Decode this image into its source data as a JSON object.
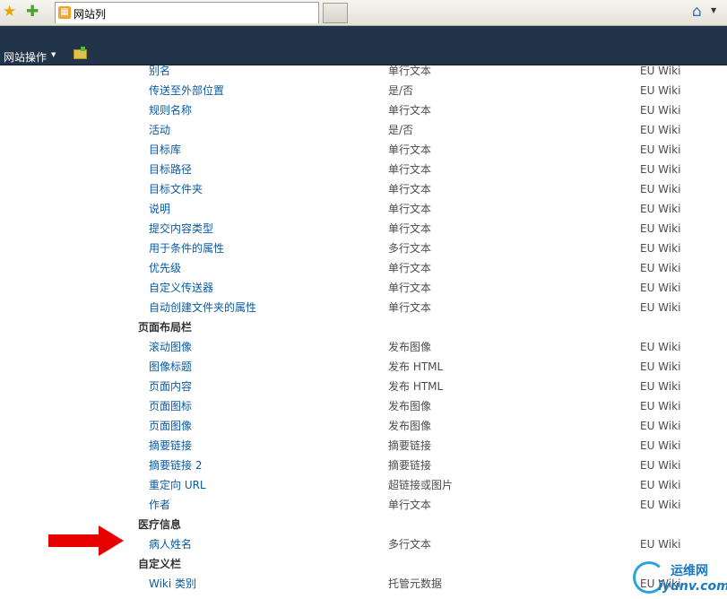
{
  "browser": {
    "tab_title": "网站列"
  },
  "ribbon": {
    "site_actions": "网站操作"
  },
  "top_rows": [
    {
      "name": "别名",
      "type": "单行文本",
      "source": "EU Wiki"
    },
    {
      "name": "传送至外部位置",
      "type": "是/否",
      "source": "EU Wiki"
    },
    {
      "name": "规则名称",
      "type": "单行文本",
      "source": "EU Wiki"
    },
    {
      "name": "活动",
      "type": "是/否",
      "source": "EU Wiki"
    },
    {
      "name": "目标库",
      "type": "单行文本",
      "source": "EU Wiki"
    },
    {
      "name": "目标路径",
      "type": "单行文本",
      "source": "EU Wiki"
    },
    {
      "name": "目标文件夹",
      "type": "单行文本",
      "source": "EU Wiki"
    },
    {
      "name": "说明",
      "type": "单行文本",
      "source": "EU Wiki"
    },
    {
      "name": "提交内容类型",
      "type": "单行文本",
      "source": "EU Wiki"
    },
    {
      "name": "用于条件的属性",
      "type": "多行文本",
      "source": "EU Wiki"
    },
    {
      "name": "优先级",
      "type": "单行文本",
      "source": "EU Wiki"
    },
    {
      "name": "自定义传送器",
      "type": "单行文本",
      "source": "EU Wiki"
    },
    {
      "name": "自动创建文件夹的属性",
      "type": "单行文本",
      "source": "EU Wiki"
    }
  ],
  "groups": {
    "page_layout": "页面布局栏",
    "medical": "医疗信息",
    "custom": "自定义栏"
  },
  "layout_rows": [
    {
      "name": "滚动图像",
      "type": "发布图像",
      "source": "EU Wiki"
    },
    {
      "name": "图像标题",
      "type": "发布 HTML",
      "source": "EU Wiki"
    },
    {
      "name": "页面内容",
      "type": "发布 HTML",
      "source": "EU Wiki"
    },
    {
      "name": "页面图标",
      "type": "发布图像",
      "source": "EU Wiki"
    },
    {
      "name": "页面图像",
      "type": "发布图像",
      "source": "EU Wiki"
    },
    {
      "name": "摘要链接",
      "type": "摘要链接",
      "source": "EU Wiki"
    },
    {
      "name": "摘要链接 2",
      "type": "摘要链接",
      "source": "EU Wiki"
    },
    {
      "name": "重定向 URL",
      "type": "超链接或图片",
      "source": "EU Wiki"
    },
    {
      "name": "作者",
      "type": "单行文本",
      "source": "EU Wiki"
    }
  ],
  "medical_rows": [
    {
      "name": "病人姓名",
      "type": "多行文本",
      "source": "EU Wiki"
    }
  ],
  "custom_rows": [
    {
      "name": "Wiki 类别",
      "type": "托管元数据",
      "source": "EU Wiki"
    }
  ],
  "watermark": {
    "cn": "运维网",
    "en": "iyunv.com"
  },
  "colors": {
    "ribbon": "#21344a",
    "link": "#0a5ba3",
    "arrow": "#e60000"
  }
}
